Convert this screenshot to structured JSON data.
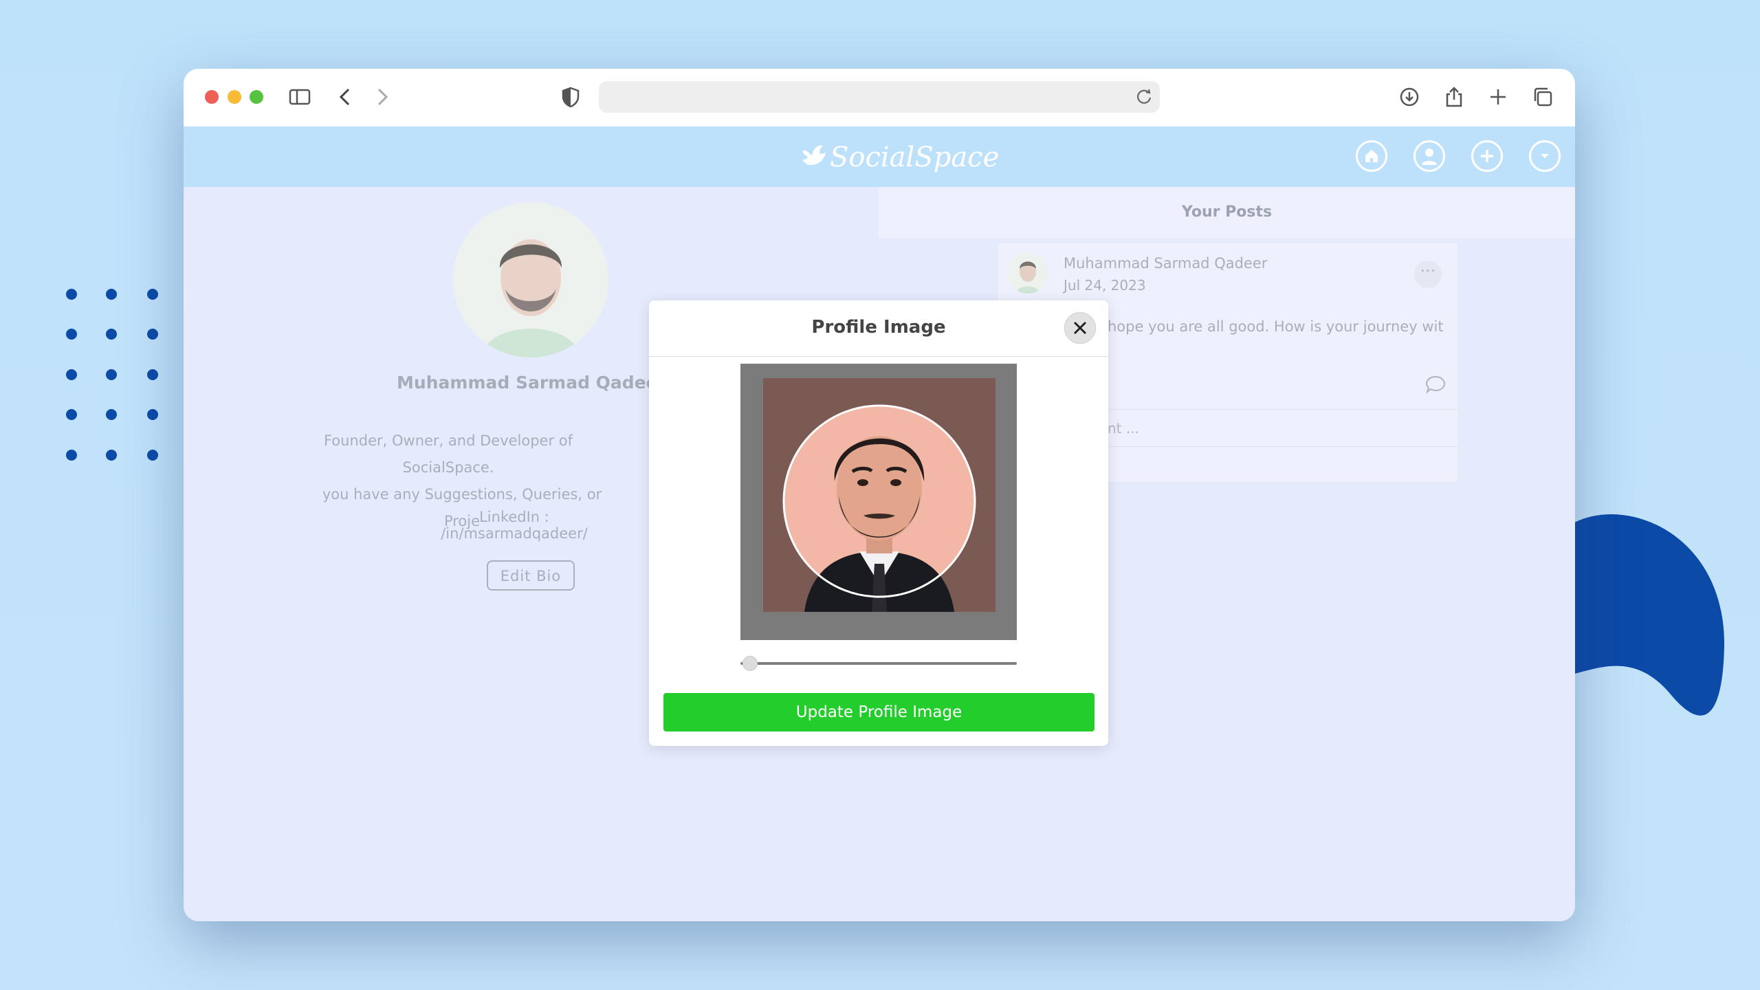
{
  "app": {
    "name": "SocialSpace"
  },
  "nav": {
    "items": [
      "home",
      "profile",
      "add",
      "menu"
    ]
  },
  "profile": {
    "name": "Muhammad Sarmad Qadeer",
    "bio_line1": "Founder, Owner, and Developer of SocialSpace.",
    "bio_line2": "you have any Suggestions, Queries, or Proje",
    "linkedin": "LinkedIn : /in/msarmadqadeer/",
    "edit_bio": "Edit Bio"
  },
  "posts": {
    "header": "Your Posts",
    "items": [
      {
        "author": "Muhammad Sarmad Qadeer",
        "date": "Jul 24, 2023",
        "text": "hope you are all good. How is your journey with",
        "comment_placeholder": "nt ...",
        "menu_label": "···"
      }
    ]
  },
  "modal": {
    "title": "Profile Image",
    "zoom_level": 0.02,
    "update_button": "Update Profile Image"
  },
  "colors": {
    "page_bg": "#bfe2fb",
    "accent": "#22cd2c",
    "app_bar": "#bee1fb",
    "decor_blue": "#0c4aa8"
  }
}
